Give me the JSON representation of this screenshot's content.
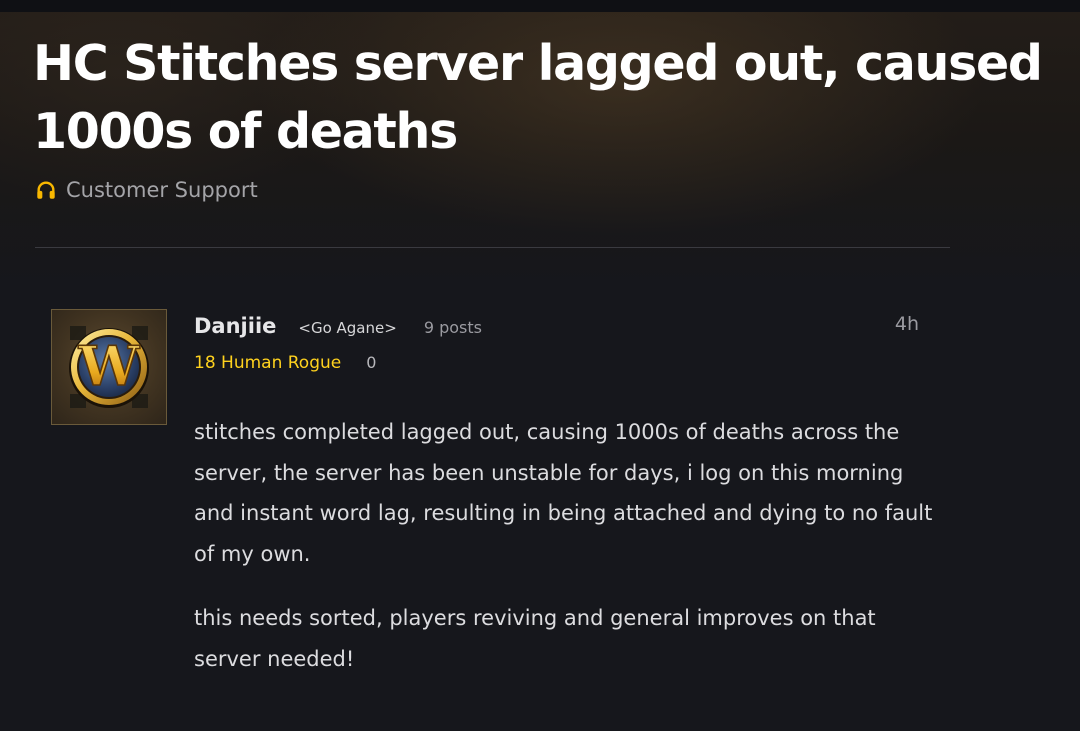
{
  "topic": {
    "title": "HC Stitches server lagged out, caused 1000s of deaths",
    "category": {
      "label": "Customer Support",
      "icon": "headphones-icon",
      "icon_color": "#f8b700"
    }
  },
  "post": {
    "author": {
      "name": "Danjiie",
      "guild": "<Go Agane>",
      "posts": "9 posts",
      "character": "18 Human Rogue",
      "character_color": "#ffd21e",
      "achievement_points": "0",
      "avatar": "wow-logo-avatar",
      "avatar_letter": "W"
    },
    "time": "4h",
    "paragraphs": [
      "stitches completed lagged out, causing 1000s of deaths across the server, the server has been unstable for days, i log on this morning and instant word lag, resulting in being attached and dying to no fault of my own.",
      "this needs sorted, players reviving and general improves on that server needed!"
    ]
  }
}
